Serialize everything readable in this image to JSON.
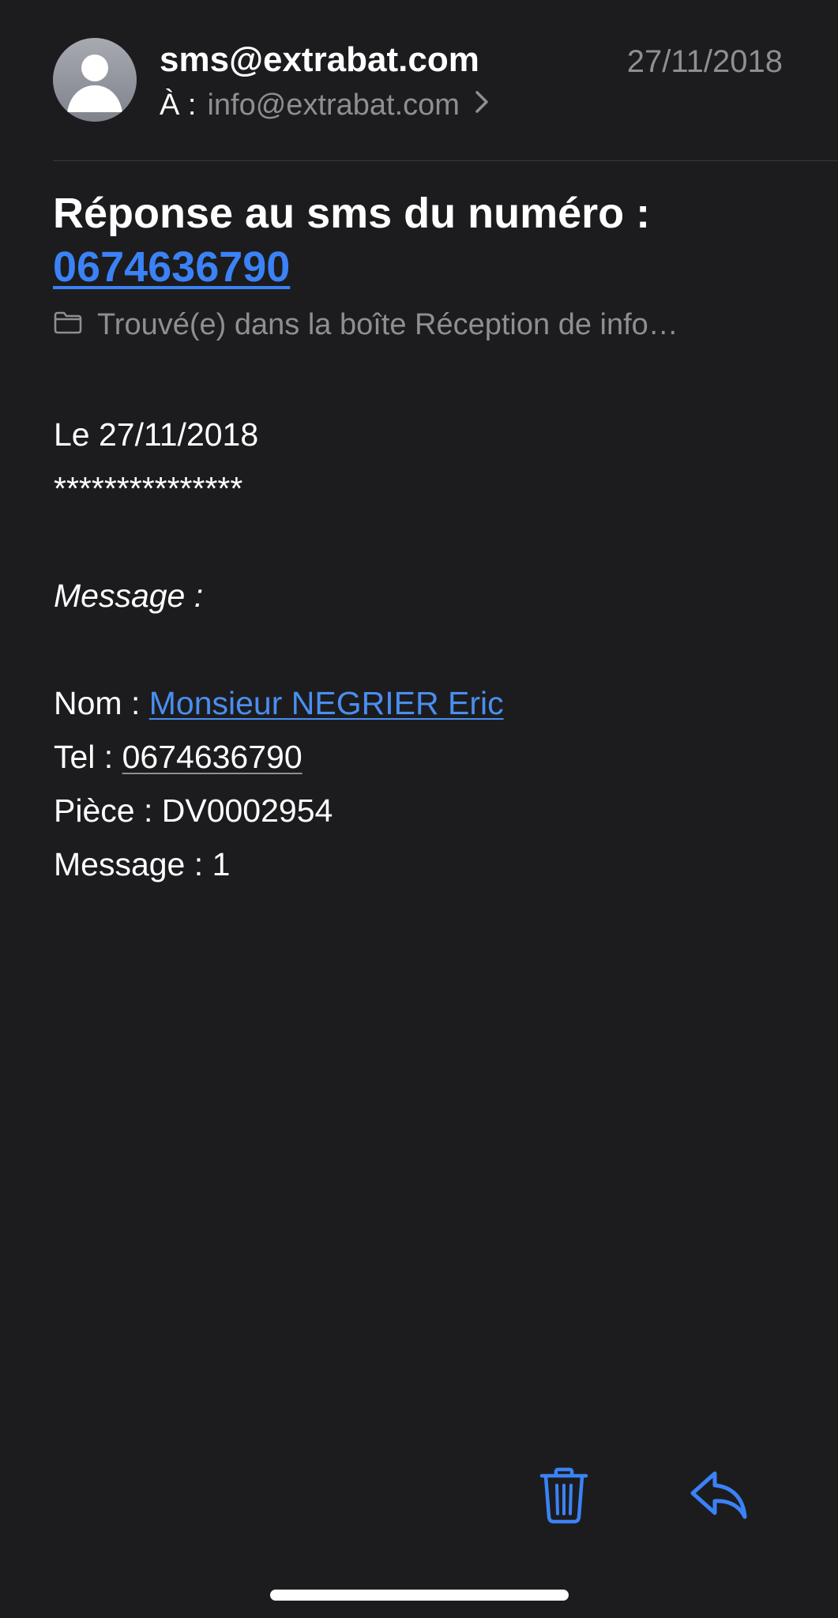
{
  "header": {
    "sender": "sms@extrabat.com",
    "date": "27/11/2018",
    "to_label": "À :",
    "to_address": "info@extrabat.com",
    "avatar_icon": "person-icon",
    "chevron_icon": "chevron-right-icon"
  },
  "subject": {
    "title": "Réponse au sms du numéro :",
    "phone_link": "0674636790"
  },
  "mailbox": {
    "icon": "folder-icon",
    "text": "Trouvé(e) dans la boîte Réception de info…"
  },
  "body": {
    "date_line": "Le 27/11/2018",
    "separator": "***************",
    "message_heading": "Message :",
    "nom_label": "Nom :",
    "nom_value": "Monsieur NEGRIER Eric",
    "tel_label": "Tel :",
    "tel_value": "0674636790",
    "piece_label": "Pièce :",
    "piece_value": "DV0002954",
    "message_label": "Message :",
    "message_value": "1"
  },
  "toolbar": {
    "trash_icon": "trash-icon",
    "reply_icon": "reply-icon"
  },
  "colors": {
    "background": "#1c1c1e",
    "accent": "#3b82f6",
    "secondary_text": "#8e8e93"
  }
}
